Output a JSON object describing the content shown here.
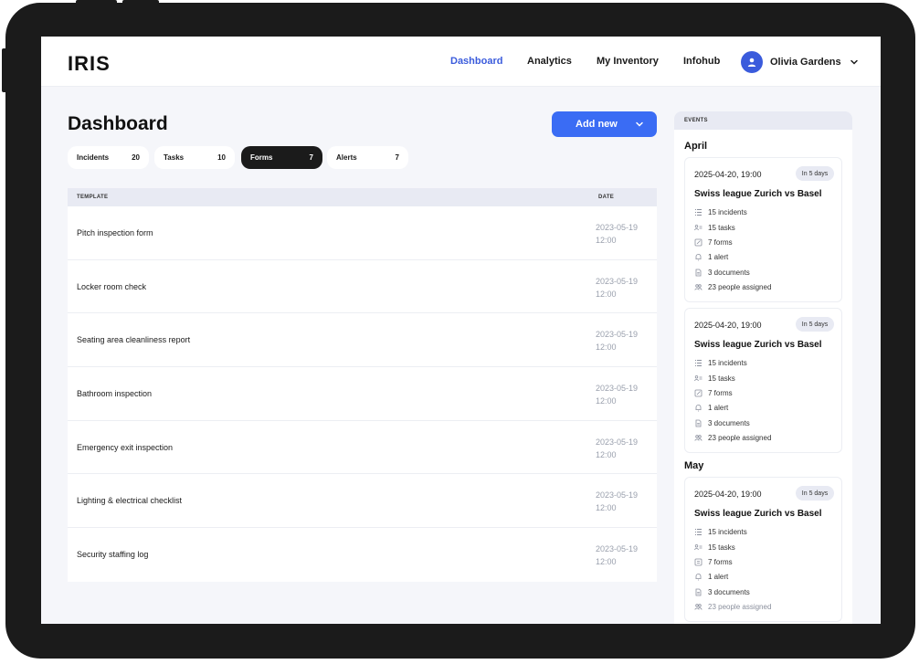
{
  "app": {
    "logo": "IRIS"
  },
  "nav": {
    "items": [
      {
        "label": "Dashboard",
        "active": true
      },
      {
        "label": "Analytics",
        "active": false
      },
      {
        "label": "My Inventory",
        "active": false
      },
      {
        "label": "Infohub",
        "active": false
      }
    ],
    "user_name": "Olivia Gardens"
  },
  "main": {
    "title": "Dashboard",
    "add_button": "Add new",
    "tabs": [
      {
        "label": "Incidents",
        "count": "20",
        "active": false
      },
      {
        "label": "Tasks",
        "count": "10",
        "active": false
      },
      {
        "label": "Forms",
        "count": "7",
        "active": true
      },
      {
        "label": "Alerts",
        "count": "7",
        "active": false
      }
    ],
    "table": {
      "col_template": "TEMPLATE",
      "col_date": "DATE",
      "rows": [
        {
          "name": "Pitch inspection form",
          "date": "2023-05-19",
          "time": "12:00"
        },
        {
          "name": "Locker room check",
          "date": "2023-05-19",
          "time": "12:00"
        },
        {
          "name": "Seating area cleanliness report",
          "date": "2023-05-19",
          "time": "12:00"
        },
        {
          "name": "Bathroom inspection",
          "date": "2023-05-19",
          "time": "12:00"
        },
        {
          "name": "Emergency exit inspection",
          "date": "2023-05-19",
          "time": "12:00"
        },
        {
          "name": "Lighting & electrical checklist",
          "date": "2023-05-19",
          "time": "12:00"
        },
        {
          "name": "Security staffing log",
          "date": "2023-05-19",
          "time": "12:00"
        }
      ]
    }
  },
  "events": {
    "header": "EVENTS",
    "months": [
      "April",
      "May"
    ],
    "cards": [
      {
        "date": "2025-04-20, 19:00",
        "badge": "In 5 days",
        "title": "Swiss league Zurich vs Basel",
        "incidents": "15 incidents",
        "tasks": "15 tasks",
        "forms": "7 forms",
        "alerts": "1 alert",
        "documents": "3 documents",
        "people": "23 people assigned"
      },
      {
        "date": "2025-04-20, 19:00",
        "badge": "In 5 days",
        "title": "Swiss league Zurich vs Basel",
        "incidents": "15 incidents",
        "tasks": "15 tasks",
        "forms": "7 forms",
        "alerts": "1 alert",
        "documents": "3 documents",
        "people": "23 people assigned"
      },
      {
        "date": "2025-04-20, 19:00",
        "badge": "In 5 days",
        "title": "Swiss league Zurich vs Basel",
        "incidents": "15 incidents",
        "tasks": "15 tasks",
        "forms": "7 forms",
        "alerts": "1 alert",
        "documents": "3 documents",
        "people": "23 people assigned"
      }
    ]
  },
  "colors": {
    "accent": "#3a5bdc",
    "button": "#3a6cf4",
    "dark": "#1b1b1b",
    "background": "#f5f6fa"
  }
}
